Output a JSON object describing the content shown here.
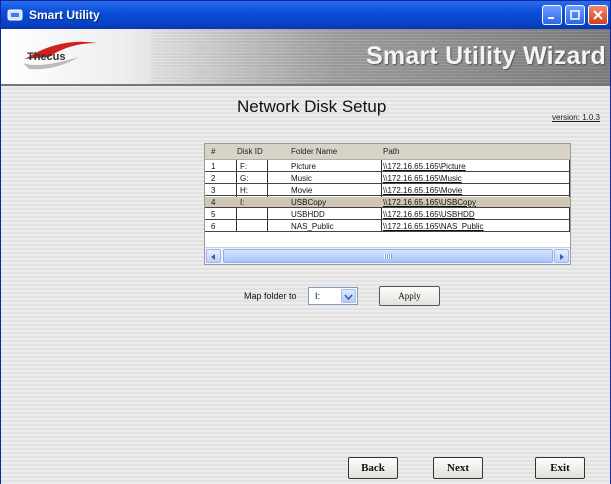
{
  "window": {
    "title": "Smart Utility"
  },
  "banner": {
    "logo_text": "Thecus",
    "wizard_title": "Smart Utility Wizard"
  },
  "page": {
    "title": "Network Disk Setup",
    "version": "version: 1.0.3"
  },
  "table": {
    "headers": [
      "#",
      "Disk ID",
      "Folder Name",
      "Path"
    ],
    "rows": [
      {
        "num": "1",
        "disk_id": "F:",
        "folder": "Picture",
        "path": "\\\\172.16.65.165\\Picture"
      },
      {
        "num": "2",
        "disk_id": "G:",
        "folder": "Music",
        "path": "\\\\172.16.65.165\\Music"
      },
      {
        "num": "3",
        "disk_id": "H:",
        "folder": "Movie",
        "path": "\\\\172.16.65.165\\Movie"
      },
      {
        "num": "4",
        "disk_id": "I:",
        "folder": "USBCopy",
        "path": "\\\\172.16.65.165\\USBCopy"
      },
      {
        "num": "5",
        "disk_id": "",
        "folder": "USBHDD",
        "path": "\\\\172.16.65.165\\USBHDD"
      },
      {
        "num": "6",
        "disk_id": "",
        "folder": "NAS_Public",
        "path": "\\\\172.16.65.165\\NAS_Public"
      }
    ],
    "selected_row": 4
  },
  "map": {
    "label": "Map folder to",
    "selected_drive": "I:",
    "apply_label": "Apply"
  },
  "nav": {
    "back_label": "Back",
    "next_label": "Next",
    "exit_label": "Exit"
  },
  "colors": {
    "titlebar": "#0a4fd8",
    "selected_row": "#cfc6b6"
  }
}
